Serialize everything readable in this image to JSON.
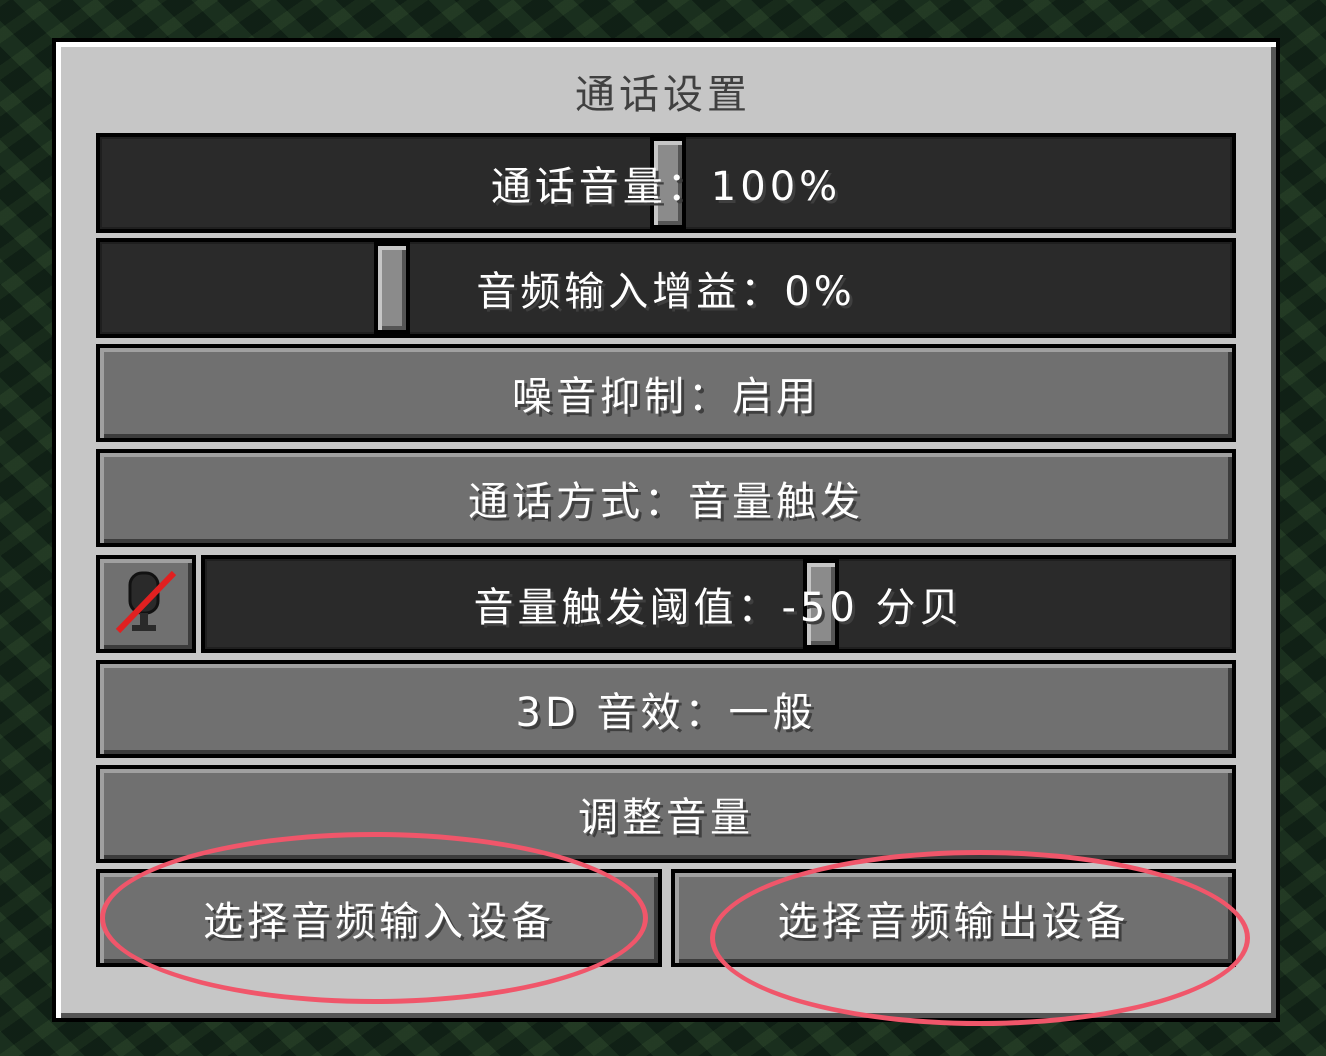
{
  "title": "通话设置",
  "rows": {
    "call_volume": {
      "label": "通话音量：100%",
      "value_fraction": 0.5
    },
    "mic_gain": {
      "label": "音频输入增益：0%",
      "value_fraction": 0.25
    },
    "denoise": {
      "label": "噪音抑制：启用"
    },
    "call_mode": {
      "label": "通话方式：音量触发"
    },
    "activation_threshold": {
      "label": "音量触发阈值：-50 分贝",
      "value_fraction": 0.6
    },
    "sound_3d": {
      "label": "3D 音效：一般"
    },
    "adjust_volume": {
      "label": "调整音量"
    },
    "select_input": {
      "label": "选择音频输入设备"
    },
    "select_output": {
      "label": "选择音频输出设备"
    }
  },
  "icons": {
    "mic_test": "mic-off-icon"
  },
  "colors": {
    "annotation": "#f0566a",
    "mute_slash": "#e02020"
  }
}
